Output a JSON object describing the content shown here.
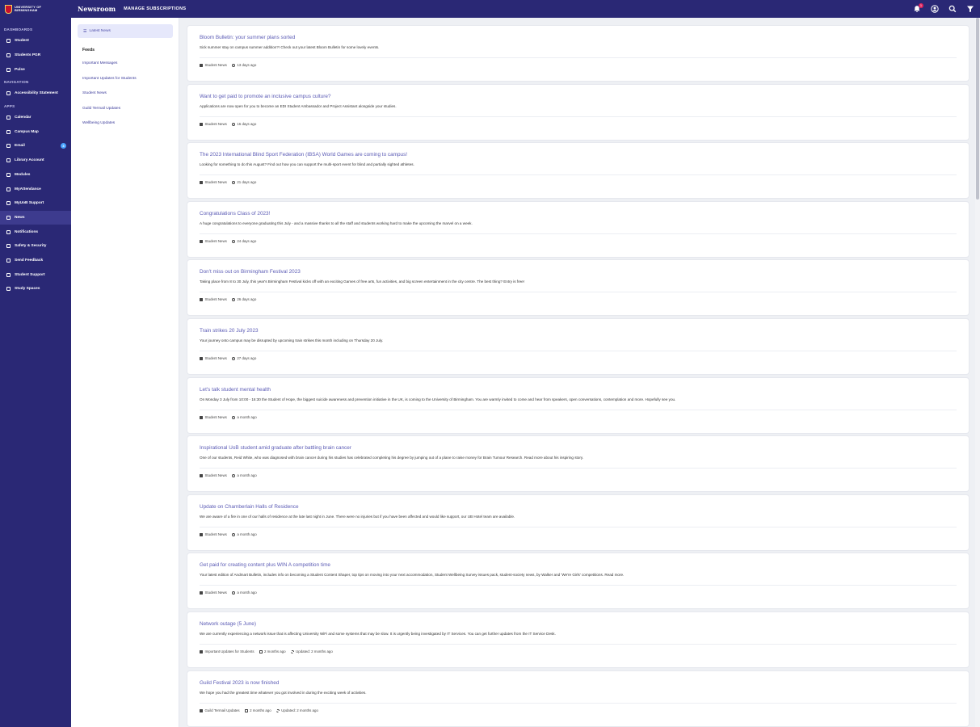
{
  "header": {
    "logo_text_1": "UNIVERSITY OF",
    "logo_text_2": "BIRMINGHAM",
    "app_title": "Newsroom",
    "app_subtitle": "MANAGE SUBSCRIPTIONS",
    "notification_count": "1"
  },
  "sidebar": {
    "sections": [
      {
        "label": "DASHBOARDS",
        "items": [
          {
            "label": "Student",
            "icon": "page-icon",
            "active": false
          },
          {
            "label": "Students PGR",
            "icon": "home-icon",
            "active": false
          },
          {
            "label": "Pulse",
            "icon": "pulse-icon",
            "active": false
          }
        ]
      },
      {
        "label": "NAVIGATION",
        "items": [
          {
            "label": "Accessibility Statement",
            "icon": "accessibility-icon",
            "active": false
          }
        ]
      },
      {
        "label": "APPS",
        "items": [
          {
            "label": "Calendar",
            "icon": "calendar-icon",
            "active": false
          },
          {
            "label": "Campus Map",
            "icon": "map-pin-icon",
            "active": false
          },
          {
            "label": "Email",
            "icon": "mail-icon",
            "active": false,
            "badge": "3"
          },
          {
            "label": "Library Account",
            "icon": "library-icon",
            "active": false
          },
          {
            "label": "Modules",
            "icon": "modules-icon",
            "active": false
          },
          {
            "label": "MyAttendance",
            "icon": "attendance-icon",
            "active": false
          },
          {
            "label": "MyUoB Support",
            "icon": "support-icon",
            "active": false
          },
          {
            "label": "News",
            "icon": "news-icon",
            "active": true
          },
          {
            "label": "Notifications",
            "icon": "notification-icon",
            "active": false
          },
          {
            "label": "Safety & Security",
            "icon": "shield-icon",
            "active": false
          },
          {
            "label": "Send Feedback",
            "icon": "feedback-icon",
            "active": false
          },
          {
            "label": "Student Support",
            "icon": "support-icon",
            "active": false
          },
          {
            "label": "Study Spaces",
            "icon": "study-icon",
            "active": false
          }
        ]
      }
    ]
  },
  "subnav": {
    "button_label": "Latest News",
    "heading": "Feeds",
    "feeds": [
      "Important Messages",
      "Important Updates for Students",
      "Student News",
      "Guild Termail Updates",
      "Wellbeing Updates"
    ]
  },
  "articles": [
    {
      "title": "Bloom Bulletin: your summer plans sorted",
      "summary": "Sick summer stay on campus summer addition?! Check out your latest Bloom Bulletin for some lovely events.",
      "feed": "Student News",
      "time": "13 days ago"
    },
    {
      "title": "Want to get paid to promote an inclusive campus culture?",
      "summary": "Applications are now open for you to become an EDI Student Ambassador and Project Assistant alongside your studies.",
      "feed": "Student News",
      "time": "16 days ago"
    },
    {
      "title": "The 2023 International Blind Sport Federation (IBSA) World Games are coming to campus!",
      "summary": "Looking for something to do this August? Find out how you can support the multi-sport event for blind and partially sighted athletes.",
      "feed": "Student News",
      "time": "21 days ago"
    },
    {
      "title": "Congratulations Class of 2023!",
      "summary": "A huge congratulations to everyone graduating this July - and a massive thanks to all the staff and students working hard to make the upcoming the marvel on a week.",
      "feed": "Student News",
      "time": "24 days ago"
    },
    {
      "title": "Don't miss out on Birmingham Festival 2023",
      "summary": "Taking place from 8 to 30 July, this year's Birmingham Festival kicks off with an exciting Games of free arts, fun activities, and big screen entertainment in the city centre. The best thing? Entry is free!",
      "feed": "Student News",
      "time": "26 days ago"
    },
    {
      "title": "Train strikes 20 July 2023",
      "summary": "Your journey onto campus may be disrupted by upcoming train strikes this month including on Thursday 20 July.",
      "feed": "Student News",
      "time": "27 days ago"
    },
    {
      "title": "Let's talk student mental health",
      "summary": "On Monday 3 July from 10:00 - 16:30 the Student of Hope, the biggest suicide awareness and prevention initiative in the UK, is coming to the University of Birmingham. You are warmly invited to come and hear from speakers, open conversations, contemplation and more. Hopefully see you.",
      "feed": "Student News",
      "time": "a month ago"
    },
    {
      "title": "Inspirational UoB student amid graduate after battling brain cancer",
      "summary": "One of our students, Reid White, who was diagnosed with brain cancer during his studies has celebrated completing his degree by jumping out of a plane to raise money for Brain Tumour Research. Read more about his inspiring story.",
      "feed": "Student News",
      "time": "a month ago"
    },
    {
      "title": "Update on Chamberlain Halls of Residence",
      "summary": "We are aware of a fire in one of our halls of residence at the late last night in June. There were no injuries but if you have been affected and would like support, our UB Hotel team are available.",
      "feed": "Student News",
      "time": "a month ago"
    },
    {
      "title": "Get paid for creating content plus WIN A competition time",
      "summary": "Your latest edition of Andmart Bulletin, includes info on becoming a Student Content Shaper, top tips on moving into your next accommodation, Student Wellbeing Survey issues pack, student-society news, by Walker and 'We're Girls' competitions. Read more.",
      "feed": "Student News",
      "time": "a month ago"
    },
    {
      "title": "Network outage (5 June)",
      "summary": "We are currently experiencing a network issue that is affecting University WiFi and some systems that may be slow. It is urgently being investigated by IT Services. You can get further updates from the IT Service Desk.",
      "feed": "Important Updates for Students",
      "time": "2 months ago",
      "updated": "Updated: 2 months ago"
    },
    {
      "title": "Guild Festival 2023 is now finished",
      "summary": "We hope you had the greatest time whatever you got involved in during the exciting week of activities.",
      "feed": "Guild Termail Updates",
      "time": "2 months ago",
      "updated": "Updated: 2 months ago"
    }
  ],
  "colors": {
    "brand": "#2a2875",
    "accent": "#5b5bb5",
    "active_nav": "#3d3b8e",
    "badge": "#4aa3ff"
  }
}
